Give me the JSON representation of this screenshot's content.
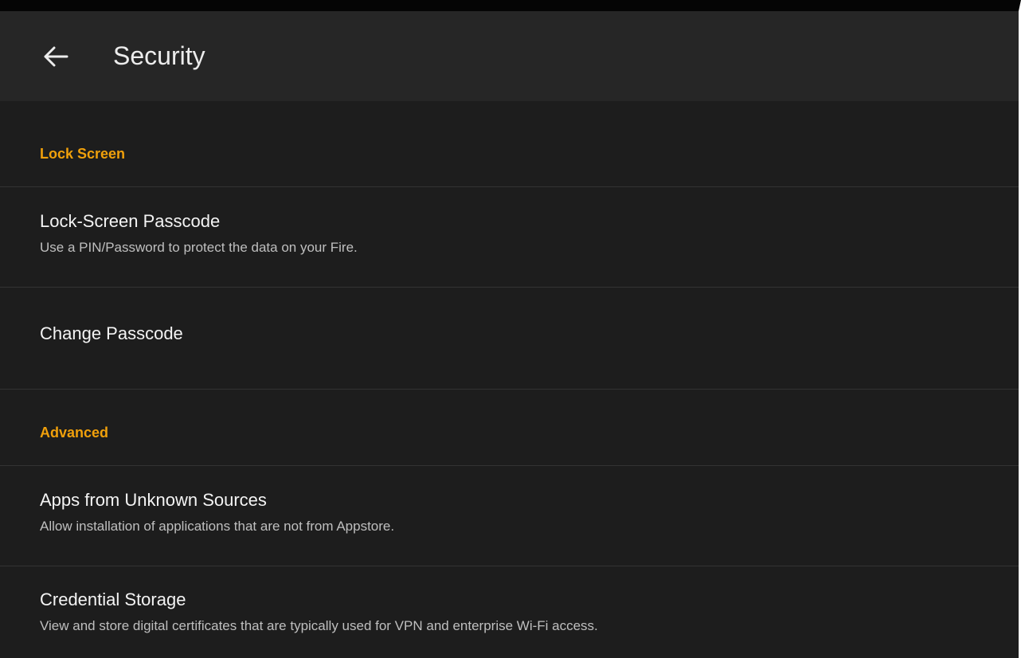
{
  "header": {
    "title": "Security",
    "back_icon": "back-arrow-icon"
  },
  "colors": {
    "section_header": "#f0a00b",
    "background": "#1d1d1d",
    "header_background": "#262626"
  },
  "sections": [
    {
      "label": "Lock Screen",
      "items": [
        {
          "title": "Lock-Screen Passcode",
          "subtitle": "Use a PIN/Password to protect the data on your Fire."
        },
        {
          "title": "Change Passcode"
        }
      ]
    },
    {
      "label": "Advanced",
      "items": [
        {
          "title": "Apps from Unknown Sources",
          "subtitle": "Allow installation of applications that are not from Appstore."
        },
        {
          "title": "Credential Storage",
          "subtitle": "View and store digital certificates that are typically used for VPN and enterprise Wi-Fi access."
        }
      ]
    }
  ]
}
